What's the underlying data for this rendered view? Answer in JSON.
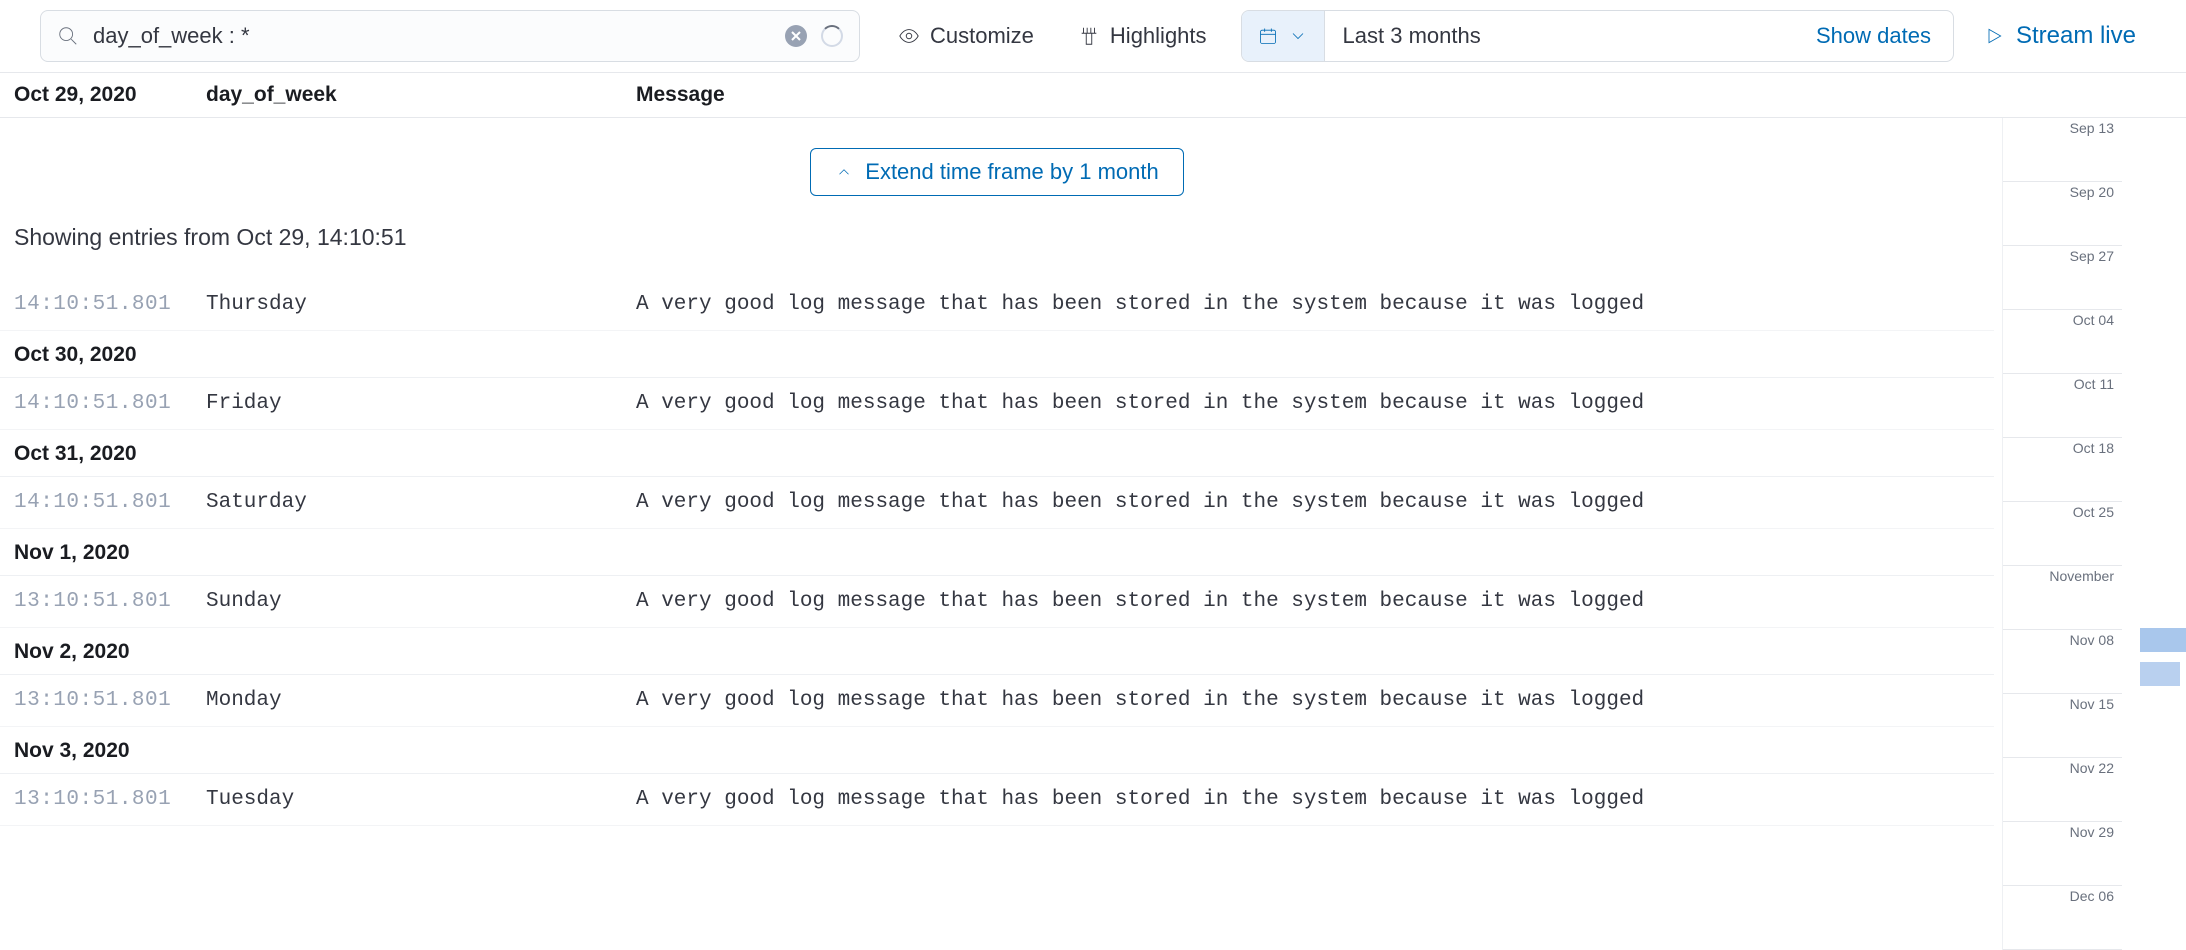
{
  "search": {
    "value": "day_of_week : *"
  },
  "toolbar": {
    "customize": "Customize",
    "highlights": "Highlights",
    "date_range": "Last 3 months",
    "show_dates": "Show dates",
    "stream_live": "Stream live"
  },
  "columns": {
    "time": "Oct 29, 2020",
    "dow": "day_of_week",
    "message": "Message"
  },
  "extend_button": "Extend time frame by 1 month",
  "showing_text": "Showing entries from Oct 29, 14:10:51",
  "days": [
    {
      "header": null,
      "rows": [
        {
          "time": "14:10:51.801",
          "dow": "Thursday",
          "msg": "A very good log message that has been stored in the system because it was logged"
        }
      ]
    },
    {
      "header": "Oct 30, 2020",
      "rows": [
        {
          "time": "14:10:51.801",
          "dow": "Friday",
          "msg": "A very good log message that has been stored in the system because it was logged"
        }
      ]
    },
    {
      "header": "Oct 31, 2020",
      "rows": [
        {
          "time": "14:10:51.801",
          "dow": "Saturday",
          "msg": "A very good log message that has been stored in the system because it was logged"
        }
      ]
    },
    {
      "header": "Nov 1, 2020",
      "rows": [
        {
          "time": "13:10:51.801",
          "dow": "Sunday",
          "msg": "A very good log message that has been stored in the system because it was logged"
        }
      ]
    },
    {
      "header": "Nov 2, 2020",
      "rows": [
        {
          "time": "13:10:51.801",
          "dow": "Monday",
          "msg": "A very good log message that has been stored in the system because it was logged"
        }
      ]
    },
    {
      "header": "Nov 3, 2020",
      "rows": [
        {
          "time": "13:10:51.801",
          "dow": "Tuesday",
          "msg": "A very good log message that has been stored in the system because it was logged"
        }
      ]
    }
  ],
  "timeline": [
    "Sep 13",
    "Sep 20",
    "Sep 27",
    "Oct 04",
    "Oct 11",
    "Oct 18",
    "Oct 25",
    "November",
    "Nov 08",
    "Nov 15",
    "Nov 22",
    "Nov 29",
    "Dec 06"
  ]
}
